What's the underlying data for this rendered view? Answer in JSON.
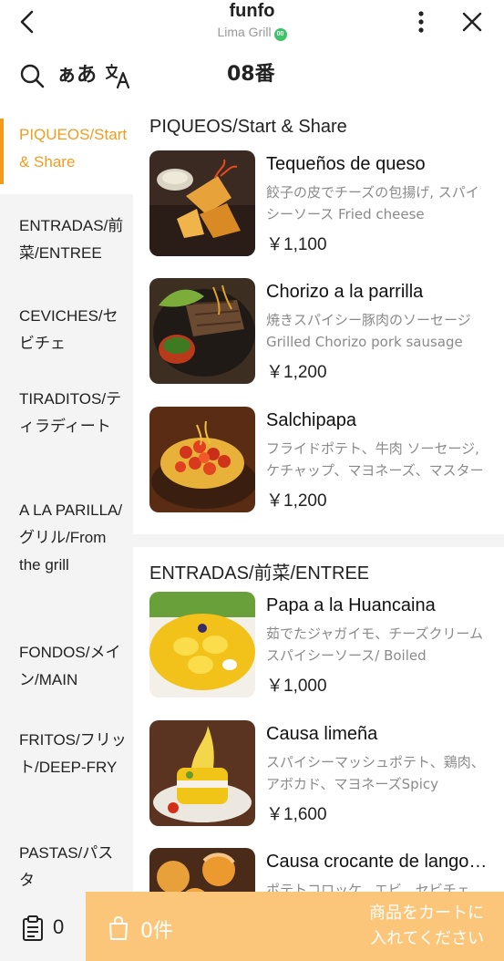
{
  "header": {
    "title": "funfo",
    "subtitle": "Lima Grill",
    "verified_badge": "00"
  },
  "toolbar": {
    "kana_label": "ぁあ",
    "table_number": "08番"
  },
  "sidebar": {
    "items": [
      {
        "label": "PIQUEOS/Start & Share",
        "active": true
      },
      {
        "label": "ENTRADAS/前菜/ENTREE"
      },
      {
        "label": "CEVICHES/セビチェ"
      },
      {
        "label": "TIRADITOS/ティラディート"
      },
      {
        "label": "A LA PARILLA/グリル/From the grill"
      },
      {
        "label": "FONDOS/メイン/MAIN"
      },
      {
        "label": "FRITOS/フリット/DEEP-FRY"
      },
      {
        "label": "PASTAS/パスタ"
      }
    ]
  },
  "sections": [
    {
      "title": "PIQUEOS/Start & Share",
      "items": [
        {
          "name": "Tequeños de queso",
          "desc": "餃子の皮でチーズの包揚げ, スパイシーソース Fried cheese wontons, spicy sauce",
          "price": "￥1,100",
          "image": "fried-wontons-photo"
        },
        {
          "name": "Chorizo a la parrilla",
          "desc": "焼きスパイシー豚肉のソーセージ Grilled Chorizo pork sausage",
          "price": "￥1,200",
          "image": "grilled-chorizo-photo"
        },
        {
          "name": "Salchipapa",
          "desc": "フライドポテト、牛肉 ソーセージ, ケチャップ、マヨネーズ、マスタード",
          "price": "￥1,200",
          "image": "salchipapa-photo"
        }
      ]
    },
    {
      "title": "ENTRADAS/前菜/ENTREE",
      "items": [
        {
          "name": "Papa a la Huancaina",
          "desc": "茹でたジャガイモ、チーズクリームスパイシーソース/ Boiled potatoes",
          "price": "￥1,000",
          "image": "papa-huancaina-photo"
        },
        {
          "name": "Causa limeña",
          "desc": "スパイシーマッシュポテト、鶏肉、アボカド、マヨネーズSpicy mashed potato",
          "price": "￥1,600",
          "image": "causa-limena-photo"
        },
        {
          "name": "Causa crocante de langostinos",
          "desc": "ポテトコロッケ、エビ、セビチェ",
          "price": "",
          "image": "causa-crocante-photo"
        }
      ]
    }
  ],
  "bottom_bar": {
    "order_count": "0",
    "cart_count": "0件",
    "add_to_cart_label": "商品をカートに入れてください"
  },
  "colors": {
    "accent": "#f39b1f",
    "cart_bar": "#fbc67a",
    "sidebar_bg": "#f4f4f4",
    "verified": "#3cc36a"
  }
}
